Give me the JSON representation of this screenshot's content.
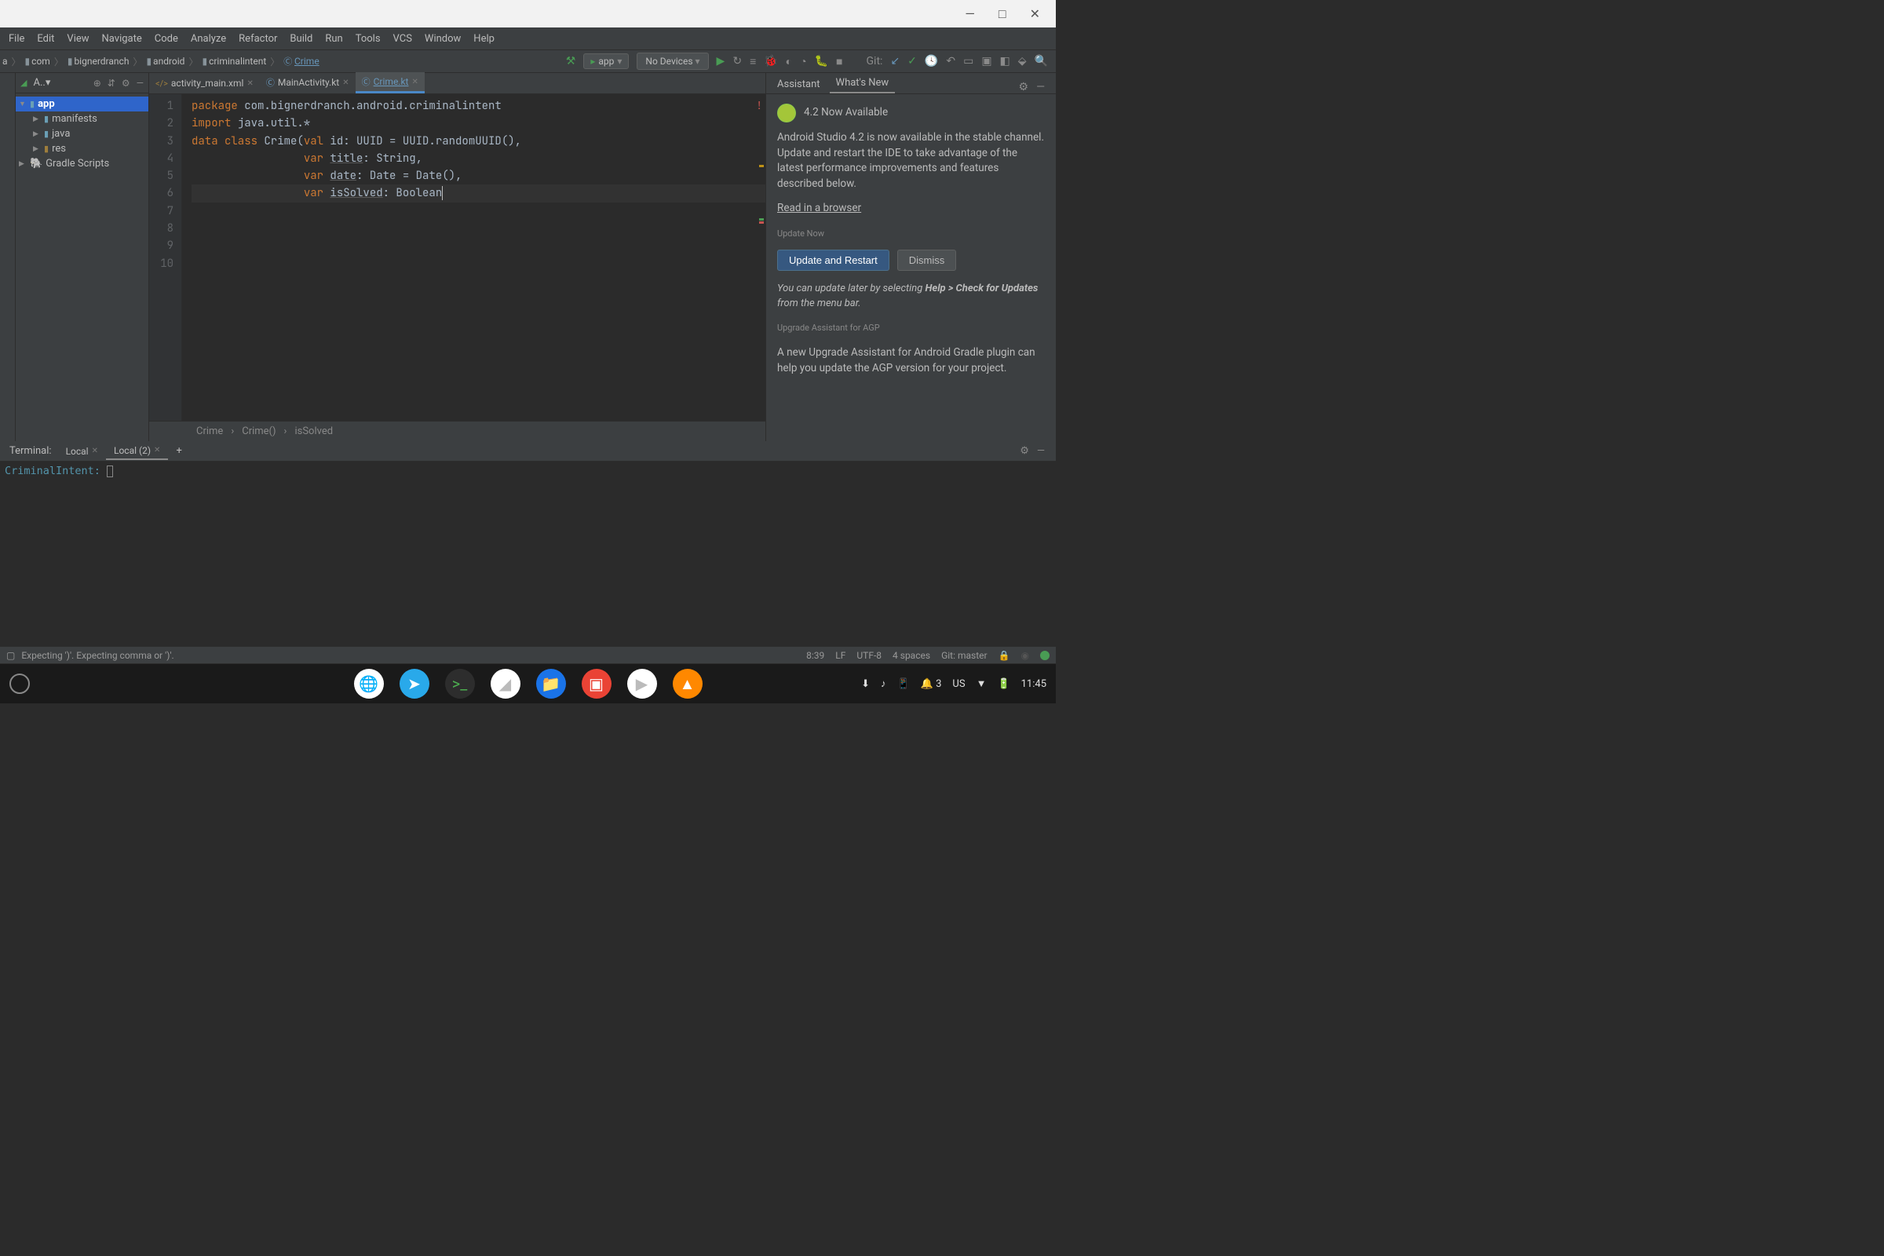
{
  "window_controls": {
    "min": "—",
    "max": "□",
    "close": "✕"
  },
  "menu": [
    "File",
    "Edit",
    "View",
    "Navigate",
    "Code",
    "Analyze",
    "Refactor",
    "Build",
    "Run",
    "Tools",
    "VCS",
    "Window",
    "Help"
  ],
  "breadcrumb": [
    "a",
    "com",
    "bignerdranch",
    "android",
    "criminalintent",
    "Crime"
  ],
  "run_config": {
    "app": "app",
    "device": "No Devices"
  },
  "nav_git_label": "Git:",
  "project": {
    "header": "A..",
    "root": "app",
    "items": [
      "manifests",
      "java",
      "res",
      "Gradle Scripts"
    ]
  },
  "tabs": [
    {
      "label": "activity_main.xml",
      "active": false,
      "type": "xml"
    },
    {
      "label": "MainActivity.kt",
      "active": false,
      "type": "kt"
    },
    {
      "label": "Crime.kt",
      "active": true,
      "type": "kt"
    }
  ],
  "code": {
    "lines": [
      {
        "n": 1,
        "tokens": [
          [
            "kw",
            "package "
          ],
          [
            "pkg",
            "com.bignerdranch.android.criminalintent"
          ]
        ]
      },
      {
        "n": 2,
        "tokens": []
      },
      {
        "n": 3,
        "tokens": [
          [
            "kw",
            "import "
          ],
          [
            "pkg",
            "java.util.*"
          ]
        ]
      },
      {
        "n": 4,
        "tokens": []
      },
      {
        "n": 5,
        "tokens": [
          [
            "kw",
            "data class "
          ],
          [
            "ident",
            "Crime("
          ],
          [
            "kw",
            "val "
          ],
          [
            "ident",
            "id: UUID = UUID.randomUUID(),"
          ]
        ]
      },
      {
        "n": 6,
        "tokens": [
          [
            "pad",
            "                 "
          ],
          [
            "kw",
            "var "
          ],
          [
            "param",
            "title"
          ],
          [
            "ident",
            ": String,"
          ]
        ]
      },
      {
        "n": 7,
        "tokens": [
          [
            "pad",
            "                 "
          ],
          [
            "kw",
            "var "
          ],
          [
            "param",
            "date"
          ],
          [
            "ident",
            ": Date = Date(),"
          ]
        ]
      },
      {
        "n": 8,
        "tokens": [
          [
            "pad",
            "                 "
          ],
          [
            "kw",
            "var "
          ],
          [
            "param",
            "isSolved"
          ],
          [
            "ident",
            ": Boolean"
          ]
        ]
      },
      {
        "n": 9,
        "tokens": []
      },
      {
        "n": 10,
        "tokens": []
      }
    ]
  },
  "editor_crumbs": [
    "Crime",
    "Crime()",
    "isSolved"
  ],
  "right": {
    "tabs": [
      "Assistant",
      "What's New"
    ],
    "title": "4.2 Now Available",
    "desc": "Android Studio 4.2 is now available in the stable channel. Update and restart the IDE to take advantage of the latest performance improvements and features described below.",
    "read_link": "Read in a browser",
    "update_now": "Update Now",
    "btn_primary": "Update and Restart",
    "btn_secondary": "Dismiss",
    "note_prefix": "You can update later by selecting ",
    "note_bold": "Help > Check for Updates",
    "note_suffix": " from the menu bar.",
    "agp_title": "Upgrade Assistant for AGP",
    "agp_desc": "A new Upgrade Assistant for Android Gradle plugin can help you update the AGP version for your project."
  },
  "terminal": {
    "label": "Terminal:",
    "tabs": [
      "Local",
      "Local (2)"
    ],
    "prompt": "CriminalIntent: "
  },
  "status": {
    "left": "Expecting ')'. Expecting comma or ')'.",
    "pos": "8:39",
    "sep": "LF",
    "enc": "UTF-8",
    "indent": "4 spaces",
    "branch": "Git: master"
  },
  "taskbar": {
    "right": {
      "lang": "US",
      "time": "11:45",
      "count": "3"
    }
  }
}
